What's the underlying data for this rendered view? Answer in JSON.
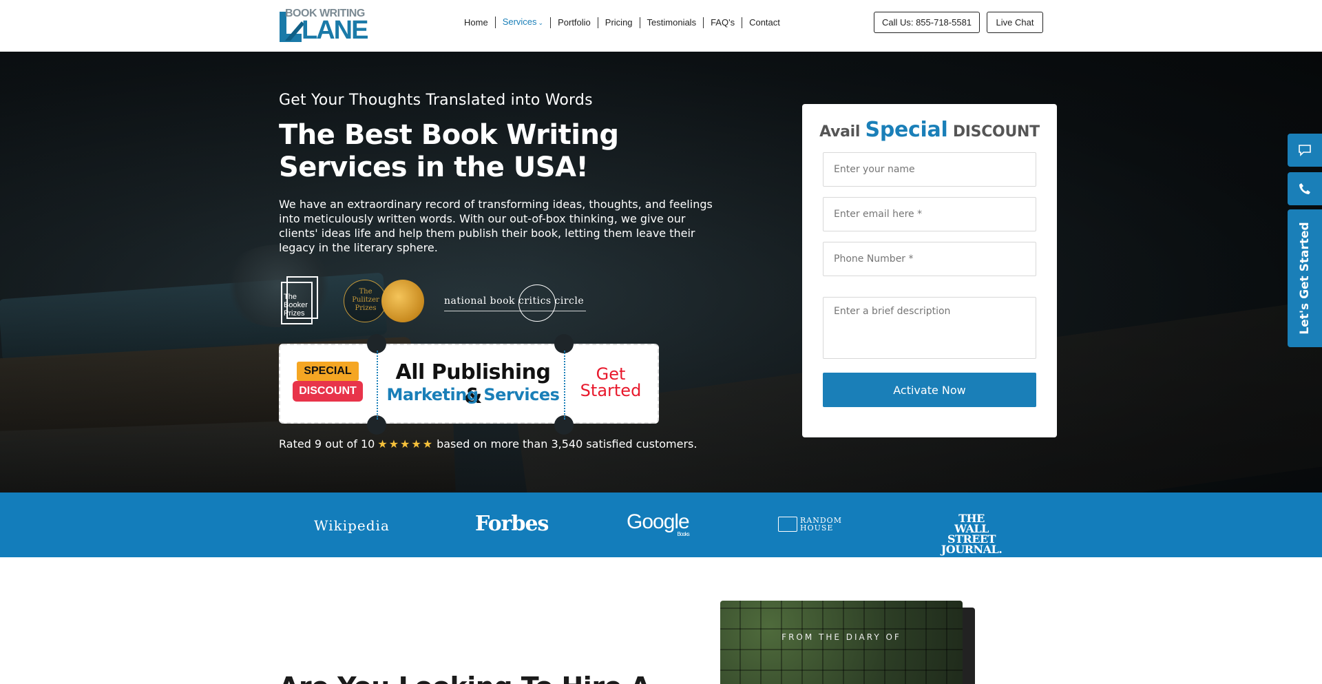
{
  "nav": {
    "logo_top": "BOOK WRITING",
    "logo_big": "LANE",
    "menu": [
      {
        "label": "Home"
      },
      {
        "label": "Services"
      },
      {
        "label": "Portfolio"
      },
      {
        "label": "Pricing"
      },
      {
        "label": "Testimonials"
      },
      {
        "label": "FAQ's"
      },
      {
        "label": "Contact"
      }
    ],
    "call_button": "Call Us: 855-718-5581",
    "chat_button": "Live Chat"
  },
  "hero": {
    "subtitle": "Get Your Thoughts Translated into Words",
    "title": "The Best Book Writing Services in the USA!",
    "description": "We have an extraordinary record of transforming ideas, thoughts, and feelings into meticulously written words. With our out-of-box thinking, we give our clients' ideas life and help them publish their book, letting them leave their legacy in the literary sphere.",
    "awards": {
      "booker": "The Booker Prizes",
      "pulitzer": "The Pulitzer Prizes",
      "nbcc_left": "national book",
      "nbcc_mid": "critics",
      "nbcc_right": "circle"
    },
    "ticket": {
      "badge_top": "SPECIAL",
      "badge_bottom": "DISCOUNT",
      "line1": "All Publishing &",
      "line2": "Marketing Services",
      "cta": "Get Started"
    },
    "rating_prefix": "Rated 9 out of 10",
    "rating_stars": "★★★★★",
    "rating_suffix": "based on more than 3,540 satisfied customers."
  },
  "form": {
    "title_pre": "Avail",
    "title_special": "Special",
    "title_post": "DISCOUNT",
    "name_placeholder": "Enter your name",
    "email_placeholder": "Enter email here *",
    "phone_placeholder": "Phone Number *",
    "desc_placeholder": "Enter a brief description",
    "submit": "Activate Now"
  },
  "side": {
    "cta": "Let's Get Started"
  },
  "press": {
    "logos": [
      "Wikipedia",
      "Forbes",
      "Google",
      "Books",
      "RANDOM HOUSE",
      "THE WALL STREET JOURNAL."
    ]
  },
  "below": {
    "title": "Are You Looking To Hire A",
    "book_caption": "FROM THE DIARY OF"
  },
  "colors": {
    "brand_blue": "#1a7fb8",
    "press_bar": "#137dbb",
    "cta_red": "#e8192c",
    "star": "#f6c13b"
  }
}
